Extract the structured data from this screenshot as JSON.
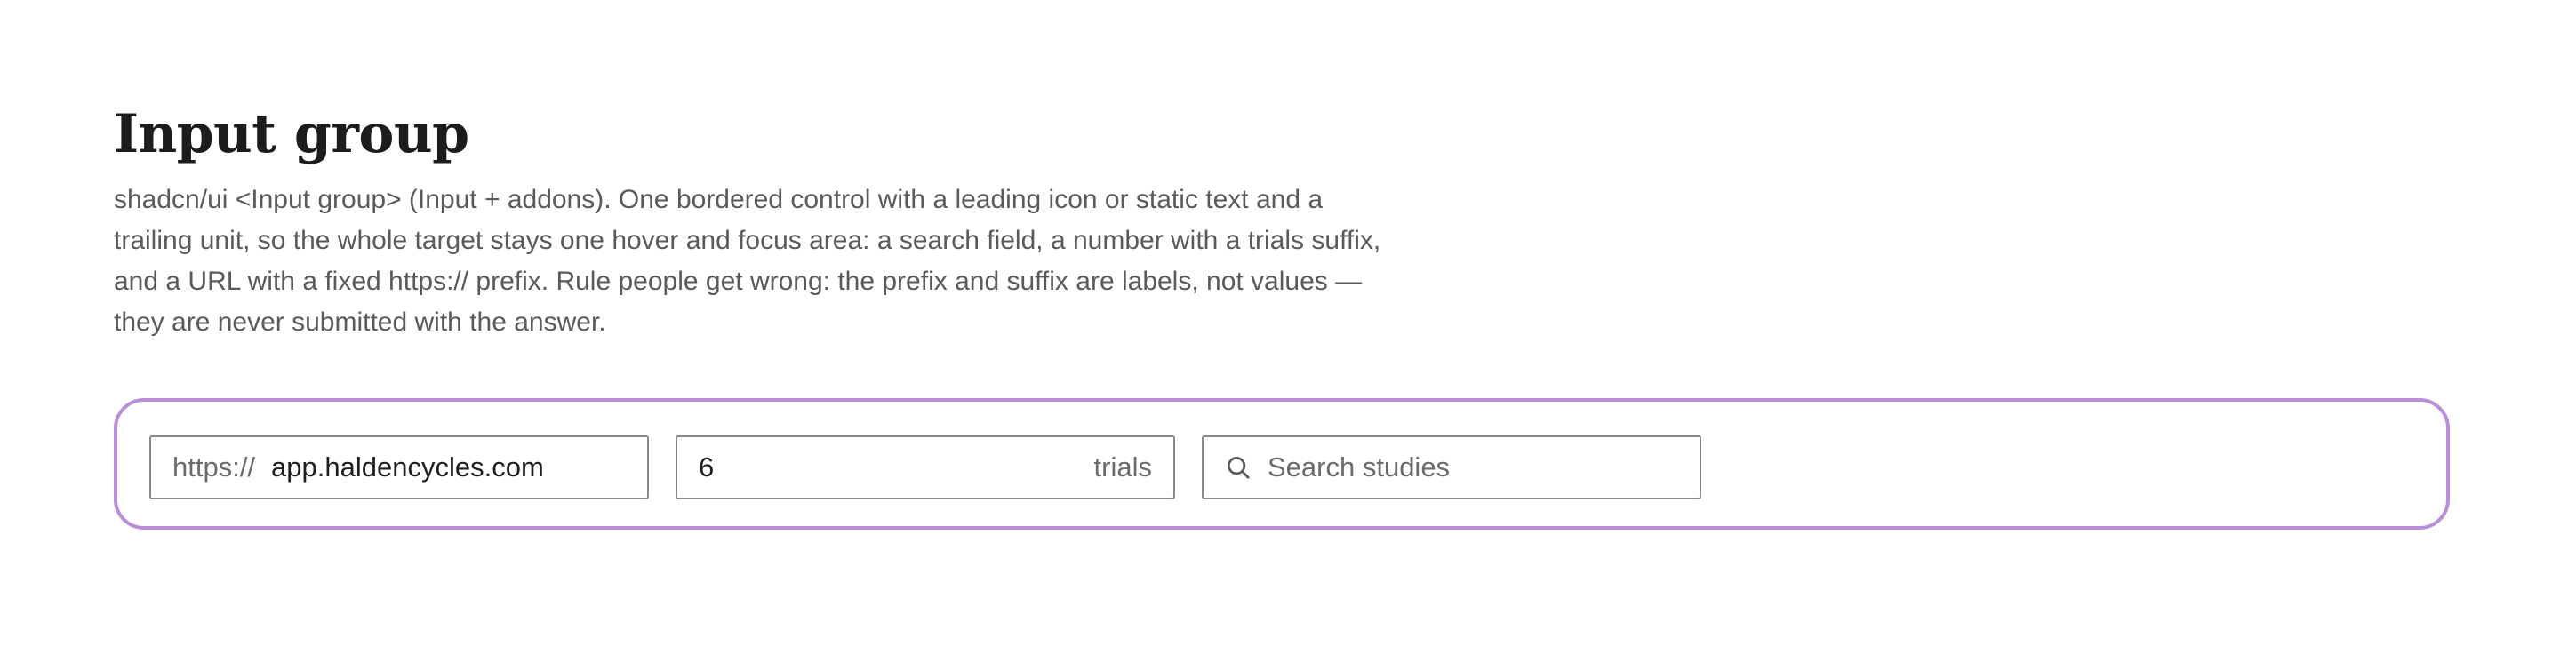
{
  "header": {
    "title": "Input group",
    "description": "shadcn/ui <Input group> (Input + addons). One bordered control with a leading icon or static text and a trailing unit, so the whole target stays one hover and focus area: a search field, a number with a trials suffix, and a URL with a fixed https:// prefix. Rule people get wrong: the prefix and suffix are labels, not values — they are never submitted with the answer."
  },
  "demo": {
    "accent_color": "#b98fd9",
    "url_group": {
      "prefix": "https://",
      "value": "app.haldencycles.com"
    },
    "number_group": {
      "value": "6",
      "suffix": "trials"
    },
    "search_group": {
      "icon": "search-icon",
      "placeholder": "Search studies",
      "value": ""
    }
  }
}
